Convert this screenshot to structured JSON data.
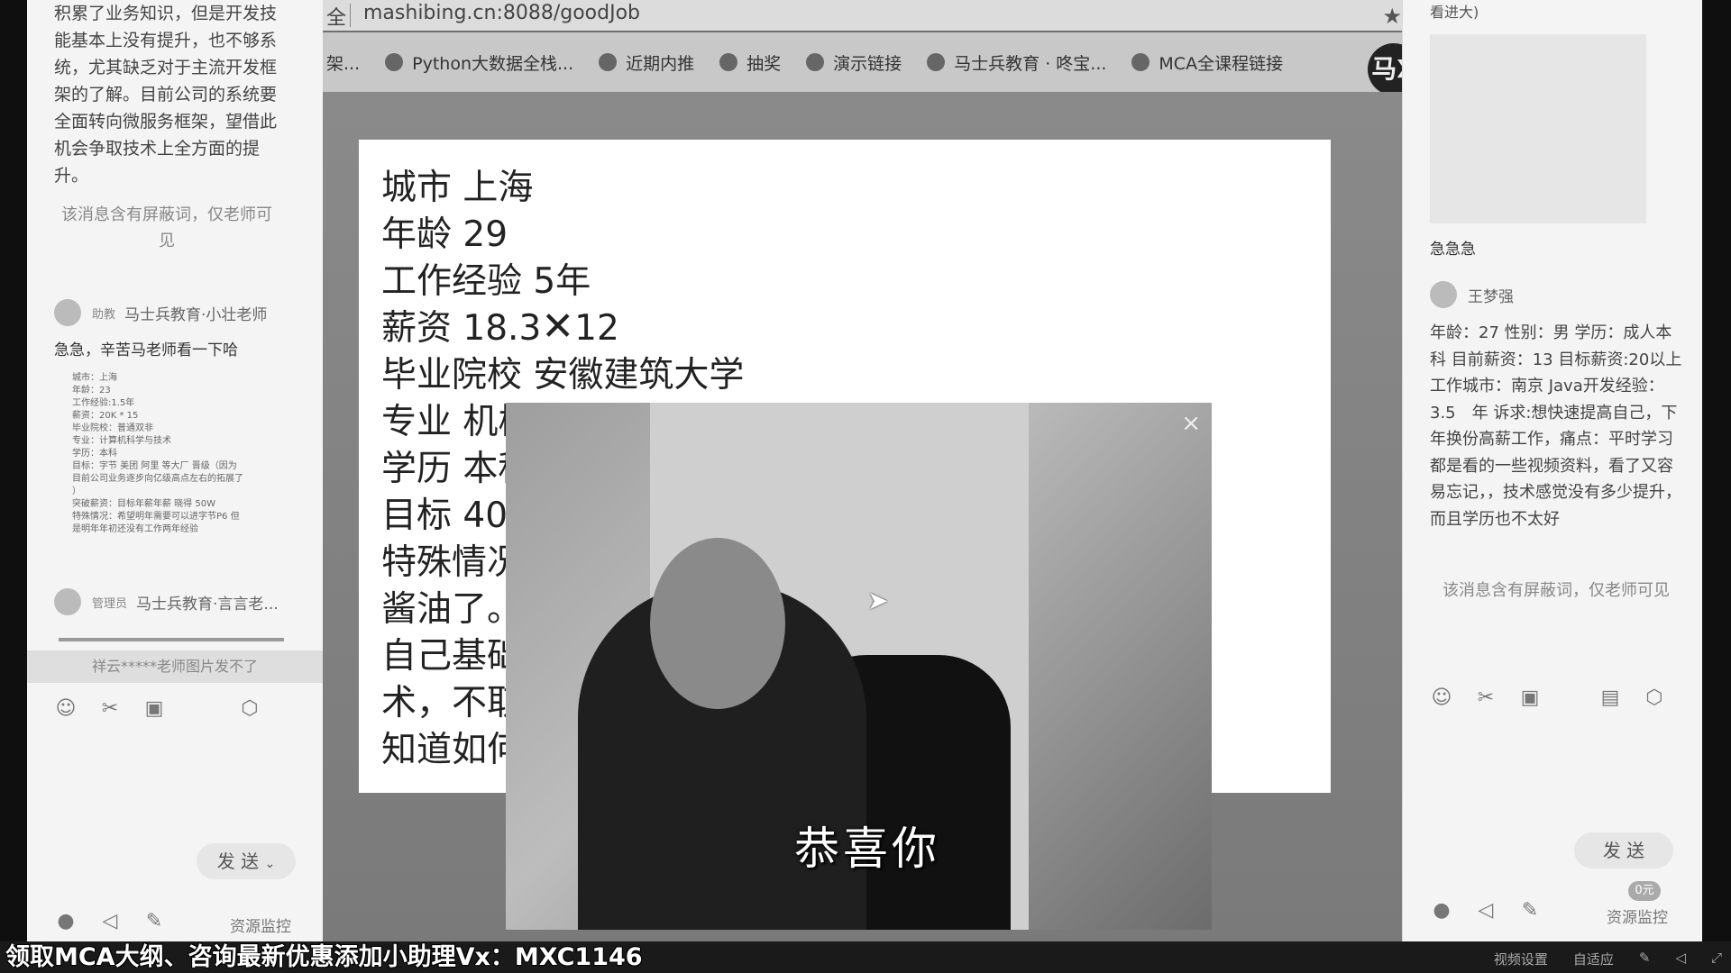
{
  "left_panel": {
    "message_lines": [
      "积累了业务知识，但是开发技",
      "能基本上没有提升，也不够系",
      "统，尤其缺乏对于主流开发框",
      "架的了解。目前公司的系统要",
      "全面转向微服务框架，望借此",
      "机会争取技术上全方面的提",
      "升。"
    ],
    "censored_note": "该消息含有屏蔽词，仅老师可见",
    "user1": {
      "role": "助教",
      "name": "马士兵教育·小壮老师"
    },
    "user1_message": "急急，辛苦马老师看一下哈",
    "tiny_card": [
      "城市：上海",
      "年龄：23",
      "工作经验:1.5年",
      "薪资：20K * 15",
      "毕业院校：普通双非",
      "专业：计算机科学与技术",
      "学历：本科",
      "目标：字节 美团 阿里 等大厂 晋级（因为",
      "目前公司业务逐步向亿级高点左右的拓展了",
      "）",
      "突破薪资：目标年薪年薪 晓得 50W",
      "特殊情况：希望明年需要可以进字节P6 但",
      "是明年年初还没有工作两年经验"
    ],
    "user2": {
      "role": "管理员",
      "name": "马士兵教育·言言老..."
    },
    "image_fail_note": "祥云*****老师图片发不了",
    "send_label": "发 送",
    "resource_monitor": "资源监控"
  },
  "browser": {
    "address_prefix": "全",
    "url": "mashibing.cn:8088/goodJob",
    "bookmarks": [
      "架...",
      "Python大数据全栈...",
      "近期内推",
      "抽奖",
      "演示链接",
      "马士兵教育 · 咚宝...",
      "MCA全课程链接"
    ],
    "logo_text": "马X"
  },
  "document": {
    "lines": [
      {
        "label": "城市",
        "value": "上海"
      },
      {
        "label": "年龄",
        "value": "29"
      },
      {
        "label": "工作经验",
        "value": "5年"
      },
      {
        "label": "薪资",
        "value_a": "18.3",
        "value_x": "✕",
        "value_b": "12"
      },
      {
        "label": "毕业院校",
        "value": "安徽建筑大学"
      },
      {
        "label": "专业",
        "value": "机械"
      },
      {
        "label": "学历",
        "value": "本科"
      },
      {
        "label": "目标",
        "value": "40"
      },
      {
        "label": "特殊情况",
        "value": ""
      }
    ],
    "extra_lines": [
      "酱油了。",
      "自己基础",
      "术，不取",
      "知道如何"
    ]
  },
  "video": {
    "caption": "恭喜你",
    "close": "×"
  },
  "right_panel": {
    "top_text": "看进大)",
    "urgent": "急急急",
    "user": {
      "name": "王梦强"
    },
    "message": "年龄：27 性别：男 学历：成人本科 目前薪资：13 目标薪资:20以上 工作城市：南京 Java开发经验：3.5　年 诉求:想快速提高自己，下年换份高薪工作，痛点：平时学习都是看的一些视频资料，看了又容易忘记，，技术感觉没有多少提升，而且学历也不太好",
    "censored_note": "该消息含有屏蔽词，仅老师可见",
    "send_label": "发 送",
    "resource_monitor": "资源监控",
    "badge": "0元"
  },
  "bottom": {
    "promo": "领取MCA大纲、咨询最新优惠添加小助理Vx：MXC1146",
    "video_settings": "视频设置",
    "auto_fit": "自适应"
  }
}
